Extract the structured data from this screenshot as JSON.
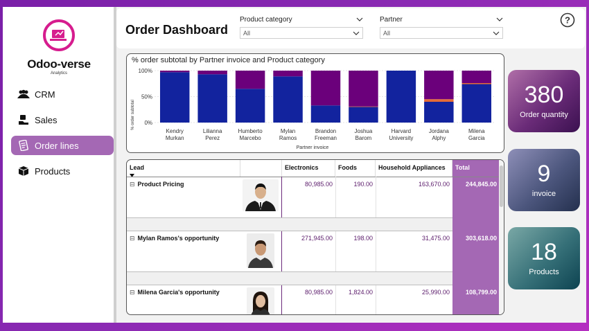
{
  "app": {
    "logo_name": "Odoo-verse",
    "logo_sub": "Analytics",
    "page_title": "Order Dashboard"
  },
  "sidebar": {
    "items": [
      {
        "label": "CRM",
        "icon": "people-icon",
        "active": false
      },
      {
        "label": "Sales",
        "icon": "handshake-icon",
        "active": false
      },
      {
        "label": "Order lines",
        "icon": "document-icon",
        "active": true
      },
      {
        "label": "Products",
        "icon": "box-icon",
        "active": false
      }
    ]
  },
  "filters": [
    {
      "label": "Product category",
      "value": "All"
    },
    {
      "label": "Partner",
      "value": "All"
    }
  ],
  "help_icon": "question-icon",
  "chart": {
    "title": "% order subtotal by Partner invoice and Product category",
    "ylabel": "% order subtotal",
    "xlabel": "Partner invoice",
    "yticks": [
      "100%",
      "50%",
      "0%"
    ]
  },
  "chart_data": {
    "type": "bar",
    "stacked": true,
    "categories": [
      "Kendry Murkan",
      "Lilianna Perez",
      "Humberto Marcebo",
      "Mylan Ramos",
      "Brandon Freeman",
      "Joshua Barom",
      "Harvard University",
      "Jordana Alphy",
      "Milena Garcia"
    ],
    "category_lines": [
      [
        "Kendry",
        "Murkan"
      ],
      [
        "Lilianna",
        "Perez"
      ],
      [
        "Humberto",
        "Marcebo"
      ],
      [
        "Mylan",
        "Ramos"
      ],
      [
        "Brandon",
        "Freeman"
      ],
      [
        "Joshua",
        "Barom"
      ],
      [
        "Harvard",
        "University"
      ],
      [
        "Jordana",
        "Alphy"
      ],
      [
        "Milena",
        "Garcia"
      ]
    ],
    "series": [
      {
        "color": "#12239e",
        "values": [
          97,
          93,
          65,
          89,
          33,
          30,
          100,
          40,
          74
        ]
      },
      {
        "color": "#e66c37",
        "values": [
          0,
          0,
          0,
          0,
          0,
          1,
          0,
          5,
          2
        ]
      },
      {
        "color": "#6b007b",
        "values": [
          3,
          7,
          35,
          11,
          67,
          69,
          0,
          55,
          24
        ]
      }
    ],
    "ylim": [
      0,
      100
    ],
    "ylabel": "% order subtotal",
    "xlabel": "Partner invoice"
  },
  "kpis": [
    {
      "value": "380",
      "label": "Order quantity"
    },
    {
      "value": "9",
      "label": "invoice"
    },
    {
      "value": "18",
      "label": "Products"
    }
  ],
  "table": {
    "headers": [
      "Lead",
      "Electronics",
      "Foods",
      "Household Appliances",
      "Total"
    ],
    "rows": [
      {
        "lead": "Product Pricing",
        "electronics": "80,985.00",
        "foods": "190.00",
        "household": "163,670.00",
        "total": "244,845.00",
        "photo": "man-suit-photo"
      },
      {
        "lead": "Mylan Ramos's opportunity",
        "electronics": "271,945.00",
        "foods": "198.00",
        "household": "31,475.00",
        "total": "303,618.00",
        "photo": "man-portrait-photo"
      },
      {
        "lead": "Milena Garcia's opportunity",
        "electronics": "80,985.00",
        "foods": "1,824.00",
        "household": "25,990.00",
        "total": "108,799.00",
        "photo": "woman-portrait-photo"
      }
    ]
  },
  "colors": {
    "accent": "#a468b4",
    "background": "#8a2ab3",
    "bar_blue": "#12239e",
    "bar_purple": "#6b007b",
    "bar_orange": "#e66c37"
  }
}
